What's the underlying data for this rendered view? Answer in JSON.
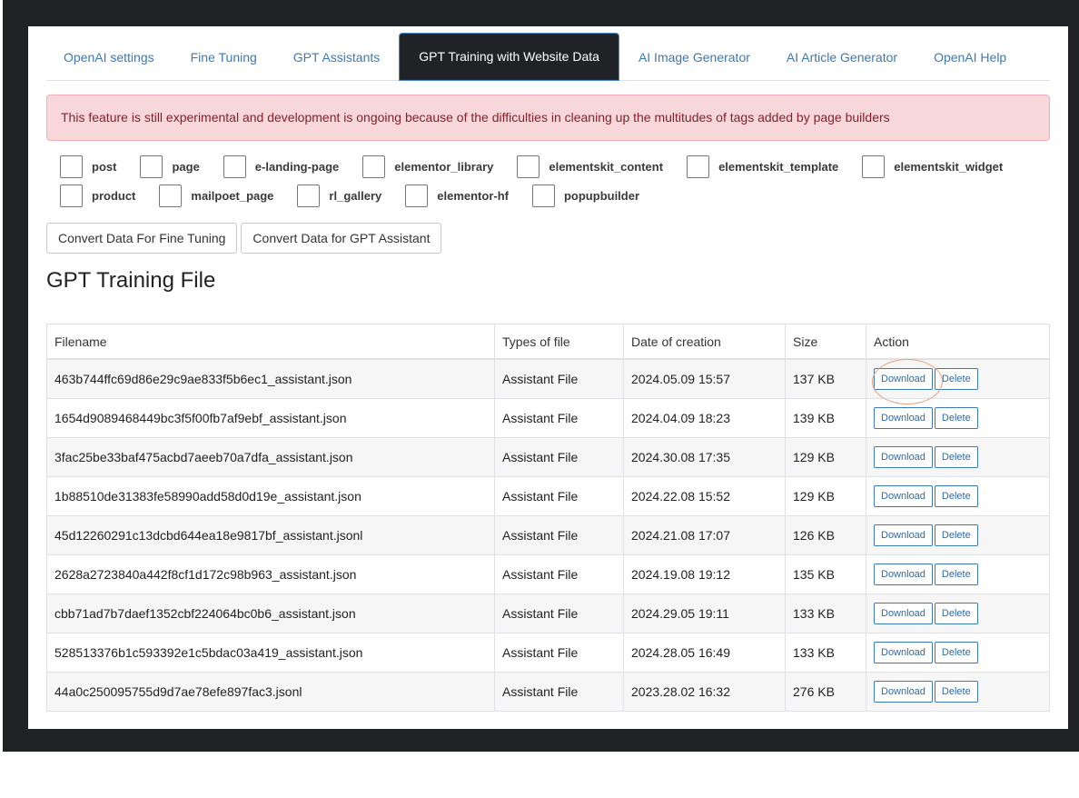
{
  "tabs": [
    {
      "label": "OpenAI settings",
      "active": false
    },
    {
      "label": "Fine Tuning",
      "active": false
    },
    {
      "label": "GPT Assistants",
      "active": false
    },
    {
      "label": "GPT Training with Website Data",
      "active": true
    },
    {
      "label": "AI Image Generator",
      "active": false
    },
    {
      "label": "AI Article Generator",
      "active": false
    },
    {
      "label": "OpenAI Help",
      "active": false
    }
  ],
  "alert": {
    "text": "This feature is still experimental and development is ongoing because of the difficulties in cleaning up the multitudes of tags added by page builders"
  },
  "post_types": {
    "row1": [
      "post",
      "page",
      "e-landing-page",
      "elementor_library",
      "elementskit_content",
      "elementskit_template",
      "elementskit_widget"
    ],
    "row2": [
      "product",
      "mailpoet_page",
      "rl_gallery",
      "elementor-hf",
      "popupbuilder"
    ]
  },
  "actions": {
    "convert_fine_tuning": "Convert Data For Fine Tuning",
    "convert_assistant": "Convert Data for GPT Assistant"
  },
  "section_title": "GPT Training File",
  "table": {
    "headers": [
      "Filename",
      "Types of file",
      "Date of creation",
      "Size",
      "Action"
    ],
    "download_label": "Download",
    "delete_label": "Delete",
    "rows": [
      {
        "filename": "463b744ffc69d86e29c9ae833f5b6ec1_assistant.json",
        "type": "Assistant File",
        "date": "2024.05.09 15:57",
        "size": "137 KB"
      },
      {
        "filename": "1654d9089468449bc3f5f00fb7af9ebf_assistant.json",
        "type": "Assistant File",
        "date": "2024.04.09 18:23",
        "size": "139 KB"
      },
      {
        "filename": "3fac25be33baf475acbd7aeeb70a7dfa_assistant.json",
        "type": "Assistant File",
        "date": "2024.30.08 17:35",
        "size": "129 KB"
      },
      {
        "filename": "1b88510de31383fe58990add58d0d19e_assistant.json",
        "type": "Assistant File",
        "date": "2024.22.08 15:52",
        "size": "129 KB"
      },
      {
        "filename": "45d12260291c13dcbd644ea18e9817bf_assistant.jsonl",
        "type": "Assistant File",
        "date": "2024.21.08 17:07",
        "size": "126 KB"
      },
      {
        "filename": "2628a2723840a442f8cf1d172c98b963_assistant.json",
        "type": "Assistant File",
        "date": "2024.19.08 19:12",
        "size": "135 KB"
      },
      {
        "filename": "cbb71ad7b7daef1352cbf224064bc0b6_assistant.json",
        "type": "Assistant File",
        "date": "2024.29.05 19:11",
        "size": "133 KB"
      },
      {
        "filename": "528513376b1c593392e1c5bdac03a419_assistant.json",
        "type": "Assistant File",
        "date": "2024.28.05 16:49",
        "size": "133 KB"
      },
      {
        "filename": "44a0c250095755d9d7ae78efe897fac3.jsonl",
        "type": "Assistant File",
        "date": "2023.28.02 16:32",
        "size": "276 KB"
      }
    ]
  },
  "colors": {
    "accent": "#3b79b9",
    "active_tab_bg": "#202226",
    "alert_bg": "#f8d7da",
    "annotation": "#e8a17a"
  }
}
